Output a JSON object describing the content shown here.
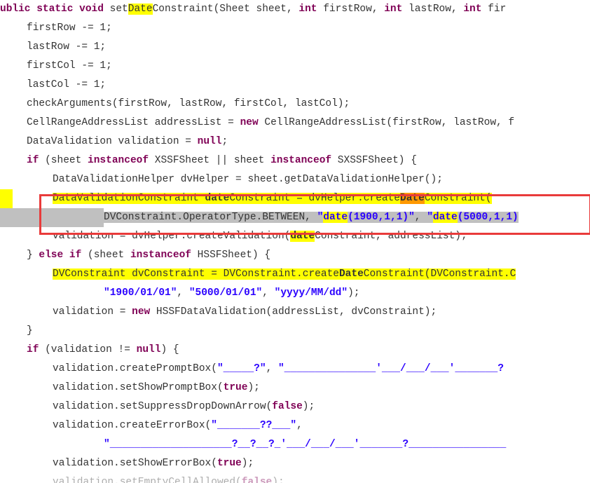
{
  "code": {
    "l1_kw1": "ublic static void",
    "l1_m1": " set",
    "l1_hl1": "Date",
    "l1_m2": "Constraint(Sheet sheet, ",
    "l1_kw2": "int",
    "l1_m3": " firstRow, ",
    "l1_kw3": "int",
    "l1_m4": " lastRow, ",
    "l1_kw4": "int",
    "l1_m5": " fir",
    "l2": "firstRow -= 1;",
    "l3": "lastRow -= 1;",
    "l4": "firstCol -= 1;",
    "l5": "lastCol -= 1;",
    "l6": "checkArguments(firstRow, lastRow, firstCol, lastCol);",
    "l7_a": "CellRangeAddressList addressList = ",
    "l7_kw": "new",
    "l7_b": " CellRangeAddressList(firstRow, lastRow, f",
    "l8_a": "DataValidation validation = ",
    "l8_kw": "null",
    "l8_b": ";",
    "l9_kw1": "if",
    "l9_a": " (sheet ",
    "l9_kw2": "instanceof",
    "l9_b": " XSSFSheet || sheet ",
    "l9_kw3": "instanceof",
    "l9_c": " SXSSFSheet) {",
    "l10": "DataValidationHelper dvHelper = sheet.getDataValidationHelper();",
    "l11_a": "DataValidationConstraint ",
    "l11_hl1": "date",
    "l11_b": "Constraint = dvHelper.create",
    "l11_hl2": "Date",
    "l11_c": "Constraint(",
    "l12_a": "DVConstraint.OperatorType.BETWEEN, ",
    "l12_s1": "\"",
    "l12_hls1": "date",
    "l12_s1b": "(1900,1,1)\"",
    "l12_b": ", ",
    "l12_s2": "\"",
    "l12_hls2": "date",
    "l12_s2b": "(5000,1,1)",
    "l13_a": "validation = dvHelper.createValidation(",
    "l13_hl": "date",
    "l13_b": "Constraint, addressList);",
    "l14_a": "} ",
    "l14_kw1": "else if",
    "l14_b": " (sheet ",
    "l14_kw2": "instanceof",
    "l14_c": " HSSFSheet) {",
    "l15_a": "DVConstraint dvConstraint = DVConstraint.create",
    "l15_hl": "Date",
    "l15_b": "Constraint(DVConstraint.C",
    "l16_s1": "\"1900/01/01\"",
    "l16_a": ", ",
    "l16_s2": "\"5000/01/01\"",
    "l16_b": ", ",
    "l16_s3": "\"yyyy/MM/dd\"",
    "l16_c": ");",
    "l17_a": "validation = ",
    "l17_kw": "new",
    "l17_b": " HSSFDataValidation(addressList, dvConstraint);",
    "l18": "}",
    "l19_kw": "if",
    "l19_a": " (validation != ",
    "l19_kw2": "null",
    "l19_b": ") {",
    "l20_a": "validation.createPromptBox(",
    "l20_s1": "\"_____?\"",
    "l20_b": ", ",
    "l20_s2": "\"_______________'___/___/___'_______?",
    "l21_a": "validation.setShowPromptBox(",
    "l21_kw": "true",
    "l21_b": ");",
    "l22_a": "validation.setSuppressDropDownArrow(",
    "l22_kw": "false",
    "l22_b": ");",
    "l23_a": "validation.createErrorBox(",
    "l23_s1": "\"_______??___\"",
    "l23_b": ",",
    "l24_s": "\"____________________?__?__?_'___/___/___'_______?________________",
    "l25_a": "validation.setShowErrorBox(",
    "l25_kw": "true",
    "l25_b": ");",
    "l26_a": "validation.setEmptyCellAllowed(",
    "l26_kw": "false",
    "l26_b": ");"
  }
}
